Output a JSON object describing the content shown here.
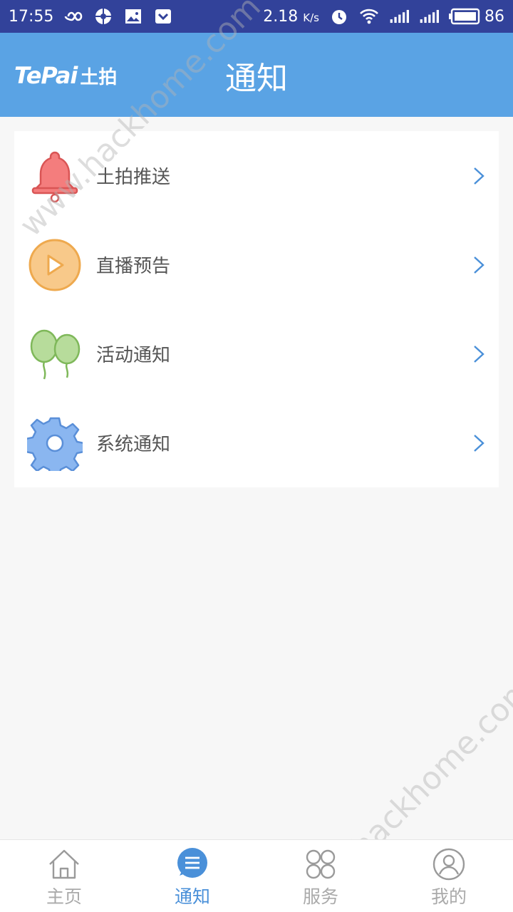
{
  "status_bar": {
    "time": "17:55",
    "net_speed": "2.18",
    "net_unit": "K/s",
    "battery": "86",
    "bg_color": "#32429a"
  },
  "header": {
    "logo_latin": "TePai",
    "logo_cn": "土拍",
    "title": "通知",
    "bg_color": "#5aa3e4"
  },
  "list": {
    "items": [
      {
        "label": "土拍推送",
        "icon": "bell-icon",
        "color": "#ef6b6b"
      },
      {
        "label": "直播预告",
        "icon": "play-icon",
        "color": "#f5b865"
      },
      {
        "label": "活动通知",
        "icon": "balloons-icon",
        "color": "#8cc26a"
      },
      {
        "label": "系统通知",
        "icon": "gear-icon",
        "color": "#6aa0e8"
      }
    ]
  },
  "watermark": {
    "text": "www.hackhome.com"
  },
  "bottom_nav": {
    "items": [
      {
        "label": "主页",
        "icon": "home-icon"
      },
      {
        "label": "通知",
        "icon": "notification-list-icon",
        "active": true
      },
      {
        "label": "服务",
        "icon": "services-icon"
      },
      {
        "label": "我的",
        "icon": "profile-icon"
      }
    ],
    "active_color": "#4a90d9"
  }
}
